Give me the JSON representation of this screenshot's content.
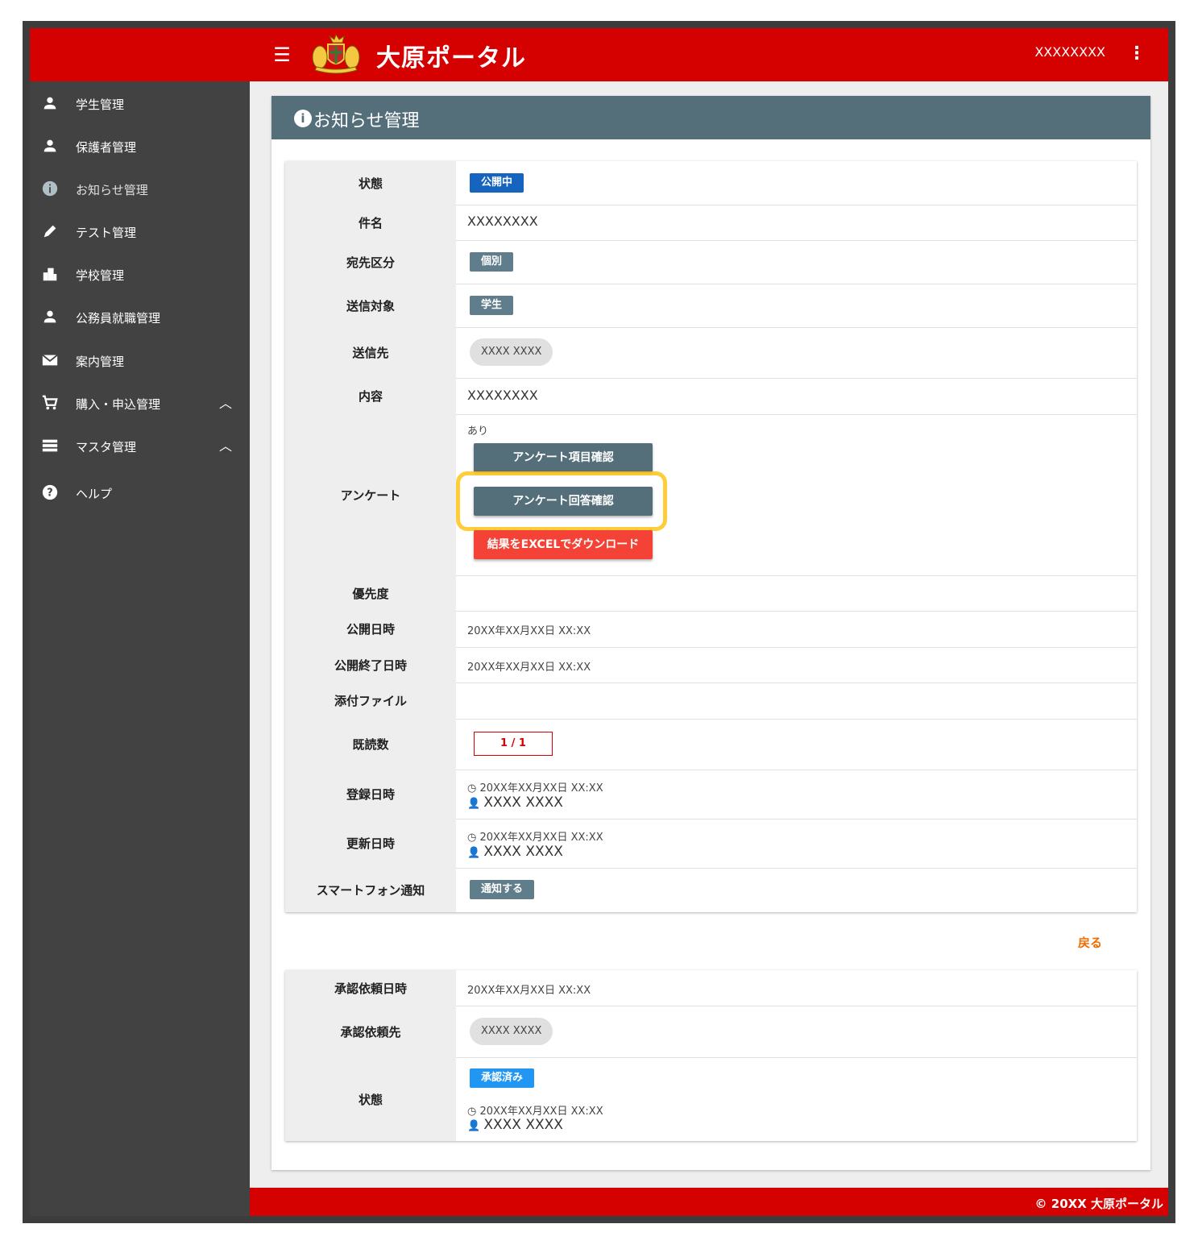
{
  "header": {
    "app_title": "大原ポータル",
    "user_name": "XXXXXXXX"
  },
  "sidebar": {
    "items": [
      {
        "label": "学生管理",
        "icon": "person-icon"
      },
      {
        "label": "保護者管理",
        "icon": "person-icon"
      },
      {
        "label": "お知らせ管理",
        "icon": "info-icon"
      },
      {
        "label": "テスト管理",
        "icon": "pencil-icon"
      },
      {
        "label": "学校管理",
        "icon": "building-icon"
      },
      {
        "label": "公務員就職管理",
        "icon": "person-icon"
      },
      {
        "label": "案内管理",
        "icon": "mail-icon"
      },
      {
        "label": "購入・申込管理",
        "icon": "cart-icon"
      },
      {
        "label": "マスタ管理",
        "icon": "list-icon"
      },
      {
        "label": "ヘルプ",
        "icon": "help-icon"
      }
    ]
  },
  "panel": {
    "title": "お知らせ管理"
  },
  "details": {
    "status_label": "状態",
    "status_value": "公開中",
    "subject_label": "件名",
    "subject_value": "XXXXXXXX",
    "dest_type_label": "宛先区分",
    "dest_type_value": "個別",
    "target_label": "送信対象",
    "target_value": "学生",
    "recipient_label": "送信先",
    "recipient_value": "XXXX XXXX",
    "content_label": "内容",
    "content_value": "XXXXXXXX",
    "survey_label": "アンケート",
    "survey_value": "あり",
    "survey_items_button": "アンケート項目確認",
    "survey_answers_button": "アンケート回答確認",
    "excel_button": "結果をEXCELでダウンロード",
    "priority_label": "優先度",
    "publish_label": "公開日時",
    "publish_value": "20XX年XX月XX日 XX:XX",
    "publish_end_label": "公開終了日時",
    "publish_end_value": "20XX年XX月XX日 XX:XX",
    "attachment_label": "添付ファイル",
    "read_count_label": "既読数",
    "read_count_value": "1 / 1",
    "registered_label": "登録日時",
    "registered_time": "20XX年XX月XX日 XX:XX",
    "registered_user": "XXXX XXXX",
    "updated_label": "更新日時",
    "updated_time": "20XX年XX月XX日 XX:XX",
    "updated_user": "XXXX XXXX",
    "push_label": "スマートフォン通知",
    "push_value": "通知する"
  },
  "back_link": "戻る",
  "approval": {
    "request_date_label": "承認依頼日時",
    "request_date_value": "20XX年XX月XX日 XX:XX",
    "request_to_label": "承認依頼先",
    "request_to_value": "XXXX XXXX",
    "status_label": "状態",
    "status_value": "承認済み",
    "status_time": "20XX年XX月XX日 XX:XX",
    "status_user": "XXXX XXXX"
  },
  "footer": {
    "copyright": "© 20XX 大原ポータル"
  }
}
